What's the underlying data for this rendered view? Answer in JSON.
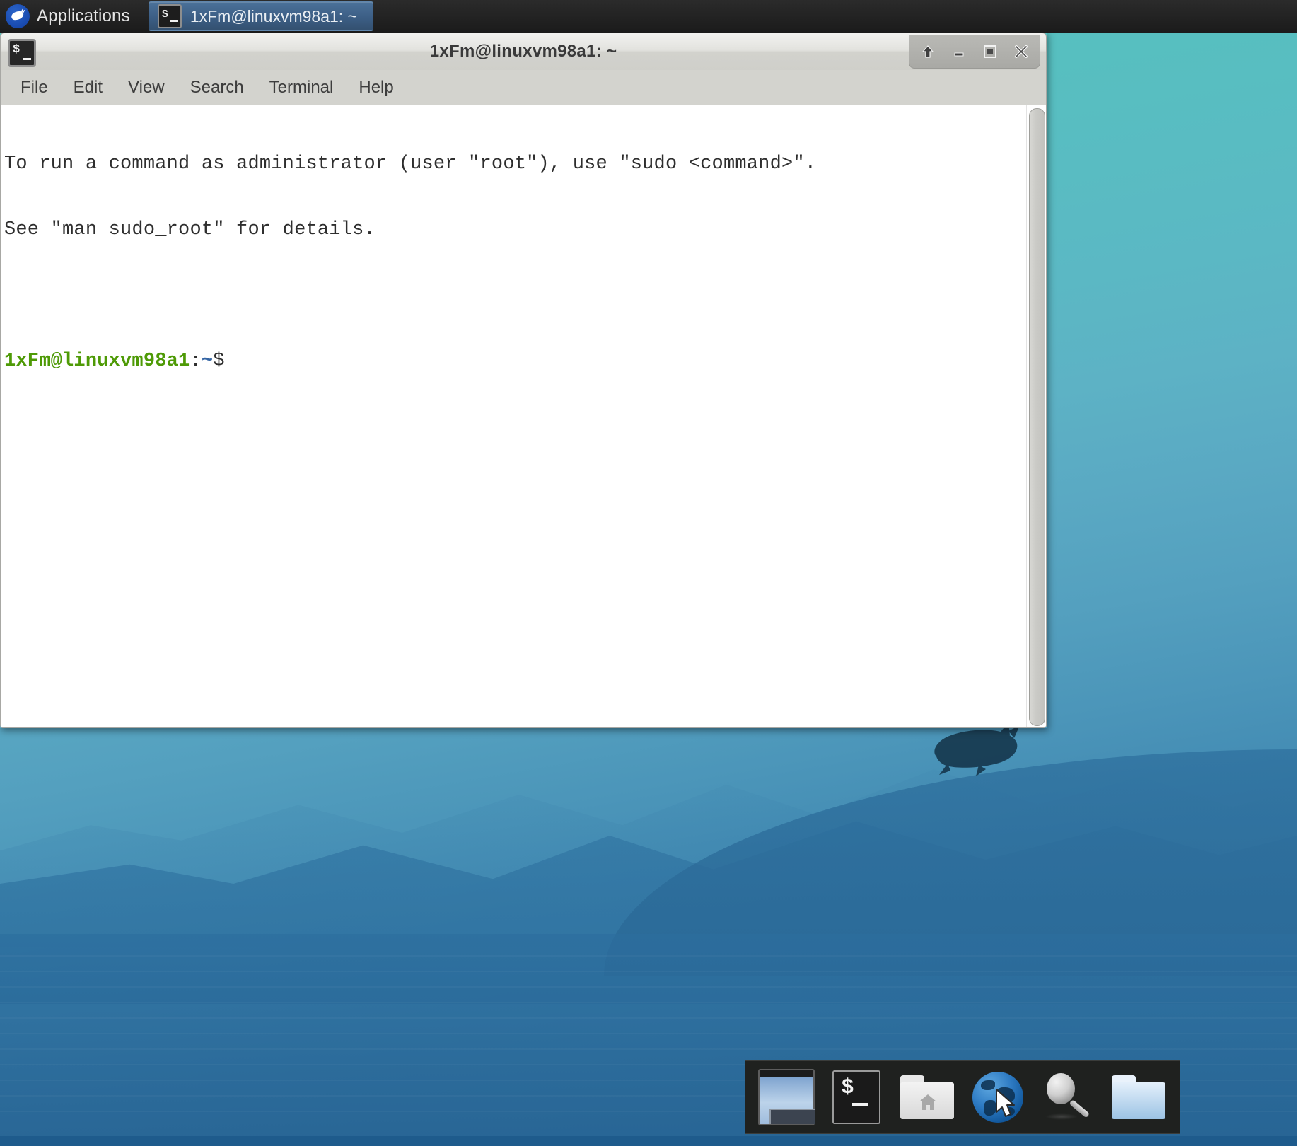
{
  "desktop": {
    "environment_name": "xfce-desktop",
    "wallpaper_logo": "xubuntu-mouse-logo",
    "colors": {
      "sky_top": "#5cc4c0",
      "water_bottom": "#2f72a0",
      "panel_bg": "#232323",
      "dock_bg": "#1f211f",
      "taskbutton_bg": "#3c5e85"
    }
  },
  "top_panel": {
    "applications_menu": {
      "label": "Applications",
      "icon": "xubuntu-mouse-icon"
    },
    "task_buttons": [
      {
        "label": "1xFm@linuxvm98a1: ~",
        "icon": "terminal-icon",
        "active": true
      }
    ]
  },
  "terminal_window": {
    "title": "1xFm@linuxvm98a1: ~",
    "icon": "terminal-icon",
    "window_controls": [
      {
        "name": "shade-button",
        "glyph": "up-arrow"
      },
      {
        "name": "minimize-button",
        "glyph": "minus"
      },
      {
        "name": "maximize-button",
        "glyph": "square"
      },
      {
        "name": "close-button",
        "glyph": "x"
      }
    ],
    "menubar": [
      {
        "label": "File"
      },
      {
        "label": "Edit"
      },
      {
        "label": "View"
      },
      {
        "label": "Search"
      },
      {
        "label": "Terminal"
      },
      {
        "label": "Help"
      }
    ],
    "output": {
      "line1": "To run a command as administrator (user \"root\"), use \"sudo <command>\".",
      "line2": "See \"man sudo_root\" for details.",
      "line3": "",
      "prompt": {
        "user_host": "1xFm@linuxvm98a1",
        "colon": ":",
        "path": "~",
        "sigil": "$",
        "command": ""
      }
    },
    "scrollbar": {
      "name": "vertical-scrollbar",
      "thumb_position": "full"
    }
  },
  "dock": {
    "items": [
      {
        "name": "show-desktop",
        "icon": "show-desktop-icon"
      },
      {
        "name": "terminal",
        "icon": "terminal-icon"
      },
      {
        "name": "home-folder",
        "icon": "home-folder-icon"
      },
      {
        "name": "web-browser",
        "icon": "globe-icon"
      },
      {
        "name": "search",
        "icon": "magnifier-icon"
      },
      {
        "name": "file-manager",
        "icon": "folder-icon"
      }
    ]
  },
  "pointer": {
    "name": "mouse-cursor",
    "over": "web-browser"
  }
}
